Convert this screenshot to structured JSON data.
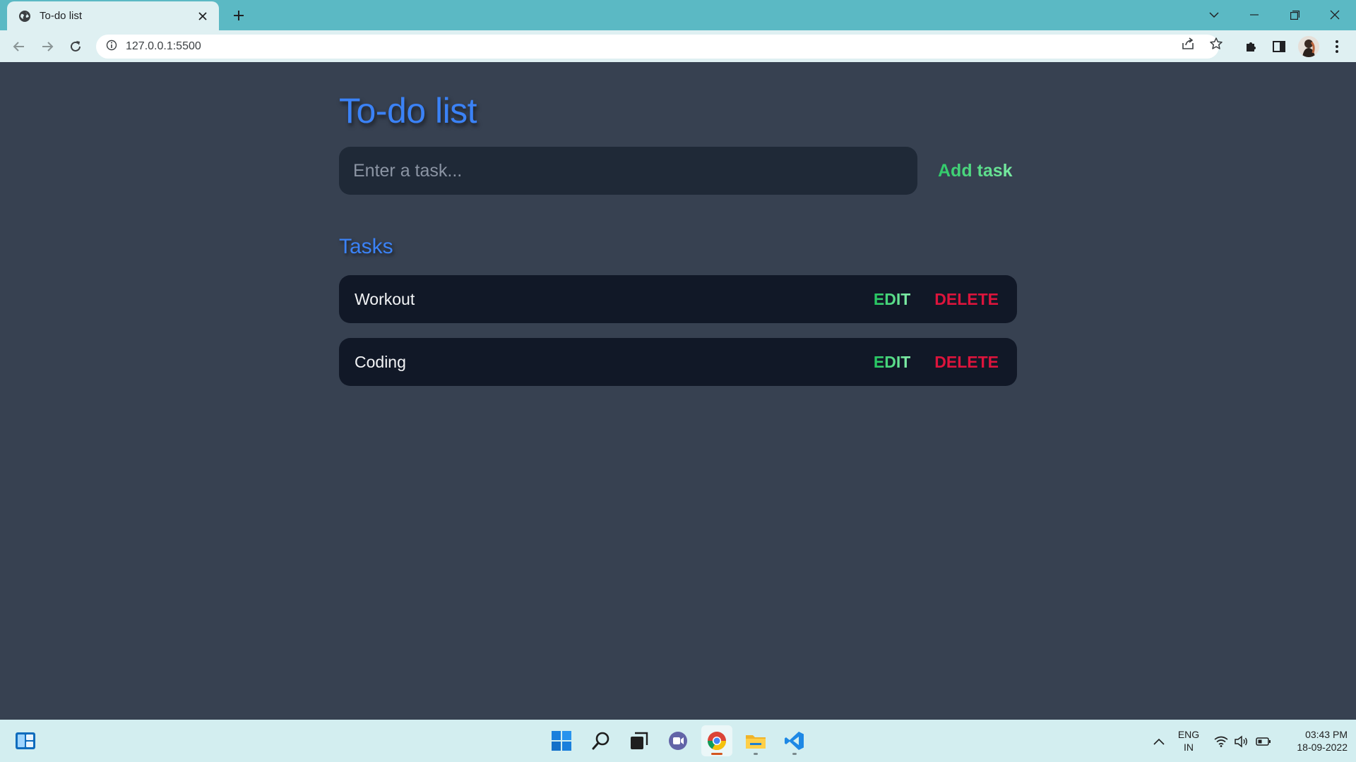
{
  "browser": {
    "tab_title": "To-do list",
    "url": "127.0.0.1:5500",
    "favicon": "globe-icon"
  },
  "app": {
    "title": "To-do list",
    "input_placeholder": "Enter a task...",
    "input_value": "",
    "add_button_label": "Add task",
    "section_title": "Tasks",
    "tasks": [
      {
        "text": "Workout",
        "edit_label": "EDIT",
        "delete_label": "DELETE"
      },
      {
        "text": "Coding",
        "edit_label": "EDIT",
        "delete_label": "DELETE"
      }
    ]
  },
  "taskbar": {
    "language": "ENG",
    "region": "IN",
    "time": "03:43 PM",
    "date": "18-09-2022"
  },
  "colors": {
    "page_background": "#374151",
    "accent_blue": "#3b82f6",
    "edit_green": "#22c55e",
    "delete_red": "#dc143c",
    "task_row": "#111827",
    "input_background": "#1f2937"
  }
}
